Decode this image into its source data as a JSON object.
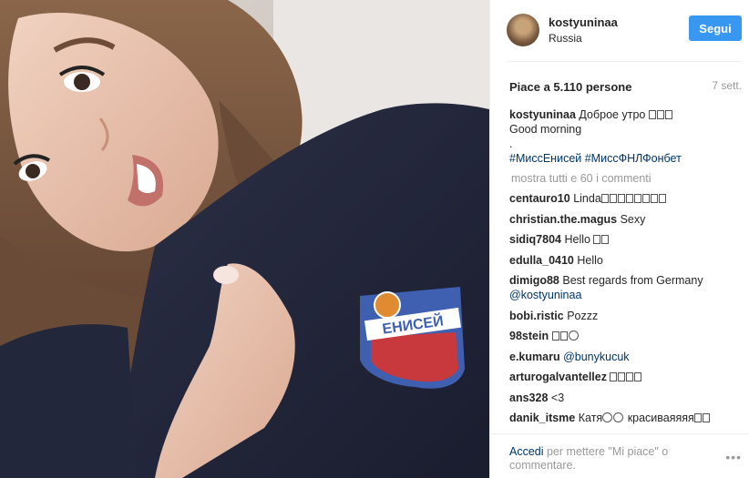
{
  "post": {
    "username": "kostyuninaa",
    "location": "Russia",
    "follow_label": "Segui",
    "likes_text": "Piace a 5.110 persone",
    "time_ago": "7 sett."
  },
  "caption": {
    "user": "kostyuninaa",
    "line1": "Доброе утро",
    "line2": "Good morning",
    "line3": ".",
    "hashtags": "#МиссЕнисей #МиссФНЛФонбет"
  },
  "show_all_label": "mostra tutti e 60 i commenti",
  "comments": [
    {
      "user": "centauro10",
      "text": "Linda"
    },
    {
      "user": "christian.the.magus",
      "text": "Sexy"
    },
    {
      "user": "sidiq7804",
      "text": "Hello"
    },
    {
      "user": "edulla_0410",
      "text": "Hello"
    },
    {
      "user": "dimigo88",
      "text": "Best regards from Germany",
      "mention": "@kostyuninaa"
    },
    {
      "user": "bobi.ristic",
      "text": "Pozzz"
    },
    {
      "user": "98stein",
      "text": ""
    },
    {
      "user": "e.kumaru",
      "text": "",
      "mention": "@bunykucuk"
    },
    {
      "user": "arturogalvantellez",
      "text": ""
    },
    {
      "user": "ans328",
      "text": "<3"
    },
    {
      "user": "danik_itsme",
      "text": "Катя",
      "tail": "красиваяяяя"
    }
  ],
  "footer": {
    "login_label": "Accedi",
    "login_rest": "per mettere \"Mi piace\" o commentare.",
    "more_icon": "ellipsis-icon"
  },
  "photo": {
    "badge_text": "ЕНИСЕЙ"
  },
  "colors": {
    "accent": "#3897f0",
    "link": "#003569",
    "muted": "#999999"
  }
}
